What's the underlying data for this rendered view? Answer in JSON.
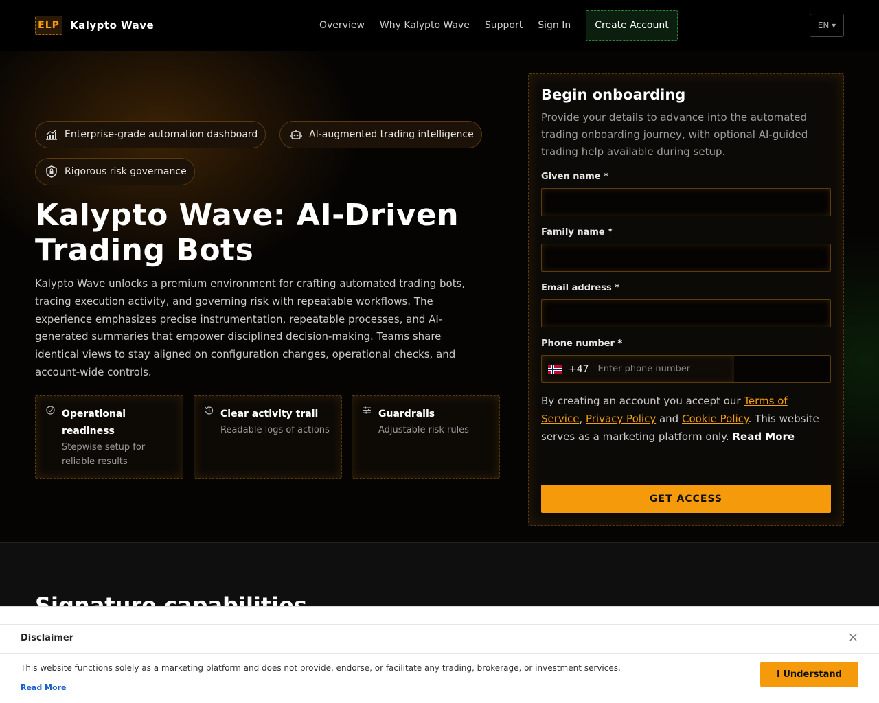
{
  "header": {
    "logo_mark": "ELP",
    "logo_text": "Kalypto Wave",
    "nav": [
      "Overview",
      "Why Kalypto Wave",
      "Support",
      "Sign In"
    ],
    "create_account": "Create Account",
    "language": "EN ▾"
  },
  "hero": {
    "chips": [
      {
        "icon": "chart-icon",
        "label": "Enterprise-grade automation dashboard"
      },
      {
        "icon": "robot-icon",
        "label": "AI-augmented trading intelligence"
      },
      {
        "icon": "shield-lock-icon",
        "label": "Rigorous risk governance"
      }
    ],
    "title": "Kalypto Wave: AI-Driven Trading Bots",
    "lead": "Kalypto Wave unlocks a premium environment for crafting automated trading bots, tracing execution activity, and governing risk with repeatable workflows. The experience emphasizes precise instrumentation, repeatable processes, and AI-generated summaries that empower disciplined decision-making. Teams share identical views to stay aligned on configuration changes, operational checks, and account-wide controls.",
    "cards": [
      {
        "icon": "check-circle-icon",
        "title": "Operational readiness",
        "desc": "Stepwise setup for reliable results"
      },
      {
        "icon": "history-icon",
        "title": "Clear activity trail",
        "desc": "Readable logs of actions"
      },
      {
        "icon": "sliders-icon",
        "title": "Guardrails",
        "desc": "Adjustable risk rules"
      }
    ]
  },
  "form": {
    "title": "Begin onboarding",
    "description": "Provide your details to advance into the automated trading onboarding journey, with optional AI-guided trading help available during setup.",
    "given_name_label": "Given name *",
    "given_name_value": "",
    "family_name_label": "Family name *",
    "family_name_value": "",
    "email_label": "Email address *",
    "email_value": "",
    "phone_label": "Phone number *",
    "phone_code": "+47",
    "phone_placeholder": "Enter phone number",
    "terms_prefix": "By creating an account you accept our ",
    "terms_link": "Terms of Service",
    "terms_sep": ", ",
    "privacy_link": "Privacy Policy",
    "terms_and": " and ",
    "cookie_link": "Cookie Policy",
    "terms_suffix": ". This website serves as a marketing platform only. ",
    "read_more": "Read More",
    "submit": "GET ACCESS"
  },
  "section2": {
    "title": "Signature capabilities"
  },
  "disclaimer": {
    "title": "Disclaimer",
    "close": "×",
    "text": "This website functions solely as a marketing platform and does not provide, endorse, or facilitate any trading, brokerage, or investment services.",
    "read_more": "Read More",
    "button": "I Understand"
  },
  "colors": {
    "accent": "#f59b0b",
    "brand_orange": "#f39c12",
    "create_green": "#2a8a3a"
  }
}
